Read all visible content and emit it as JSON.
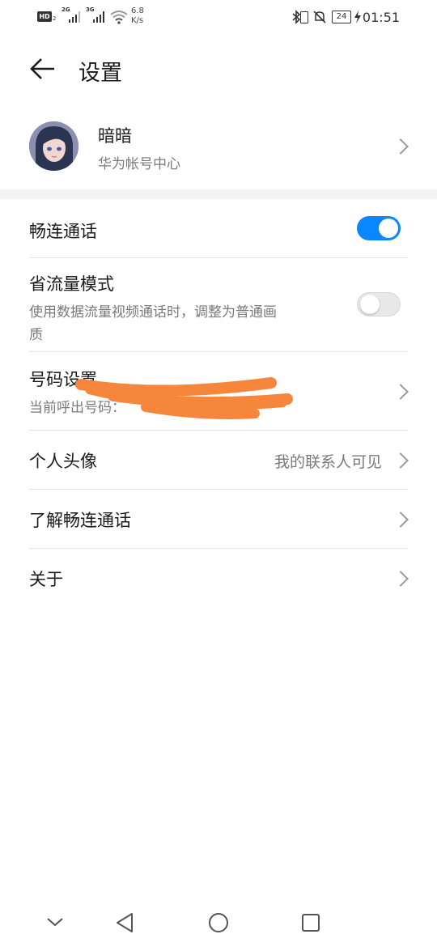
{
  "status_bar": {
    "hd": "HD",
    "hd_sub": "2",
    "sim1_net": "2G",
    "sim2_net": "3G",
    "speed_value": "6.8",
    "speed_unit": "K/s",
    "battery": "24",
    "time": "01:51"
  },
  "header": {
    "title": "设置"
  },
  "account": {
    "name": "暗暗",
    "subtitle": "华为帐号中心"
  },
  "settings": {
    "smooth_call": {
      "label": "畅连通话",
      "enabled": true
    },
    "data_saver": {
      "label": "省流量模式",
      "description_line1": "使用数据流量视频通话时，调整为普通画",
      "description_line2": "质",
      "enabled": false
    },
    "number_settings": {
      "label": "号码设置",
      "subtitle": "当前呼出号码："
    },
    "avatar": {
      "label": "个人头像",
      "value": "我的联系人可见"
    },
    "learn_more": {
      "label": "了解畅连通话"
    },
    "about": {
      "label": "关于"
    }
  },
  "colors": {
    "accent": "#0a86ff",
    "redaction": "#f5863c",
    "divider": "#e3e3e3"
  },
  "icons": [
    "back-arrow-icon",
    "chevron-right-icon",
    "bluetooth-icon",
    "mute-icon",
    "wifi-icon",
    "nav-down-icon",
    "nav-back-icon",
    "nav-home-icon",
    "nav-recents-icon"
  ]
}
